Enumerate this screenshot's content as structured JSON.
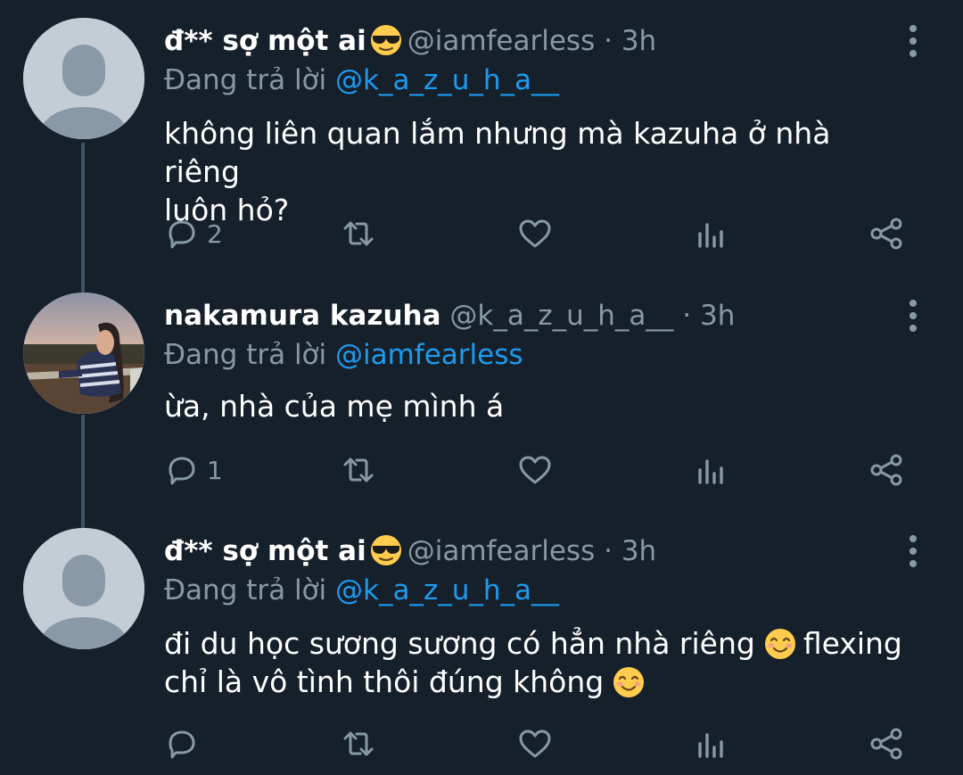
{
  "colors": {
    "background": "#15202b",
    "link": "#1d9bf0",
    "muted": "#8899a6",
    "thread_line": "#3d5466"
  },
  "tweets": [
    {
      "name": "đ** sợ một ai",
      "name_emoji": "sunglasses-emoji",
      "handle": "@iamfearless",
      "separator": "·",
      "time": "3h",
      "reply_prefix": "Đang trả lời",
      "reply_to": "@k_a_z_u_h_a__",
      "text_lines": [
        "không liên quan lắm nhưng mà kazuha ở nhà riêng",
        "luôn hỏ?"
      ],
      "reply_count": "2",
      "avatar": "default-avatar"
    },
    {
      "name": "nakamura kazuha",
      "handle": "@k_a_z_u_h_a__",
      "separator": "·",
      "time": "3h",
      "reply_prefix": "Đang trả lời",
      "reply_to": "@iamfearless",
      "text_lines": [
        "ừa, nhà của mẹ mình á"
      ],
      "reply_count": "1",
      "avatar": "photo-avatar"
    },
    {
      "name": "đ** sợ một ai",
      "name_emoji": "sunglasses-emoji",
      "handle": "@iamfearless",
      "separator": "·",
      "time": "3h",
      "reply_prefix": "Đang trả lời",
      "reply_to": "@k_a_z_u_h_a__",
      "text_line1": "đi du học sương sương có hẳn nhà riêng",
      "text_line1_suffix": "flexing",
      "text_line2": "chỉ là vô tình thôi đúng không",
      "text_emoji": "smiling-face-emoji",
      "reply_count": "",
      "avatar": "default-avatar"
    }
  ]
}
